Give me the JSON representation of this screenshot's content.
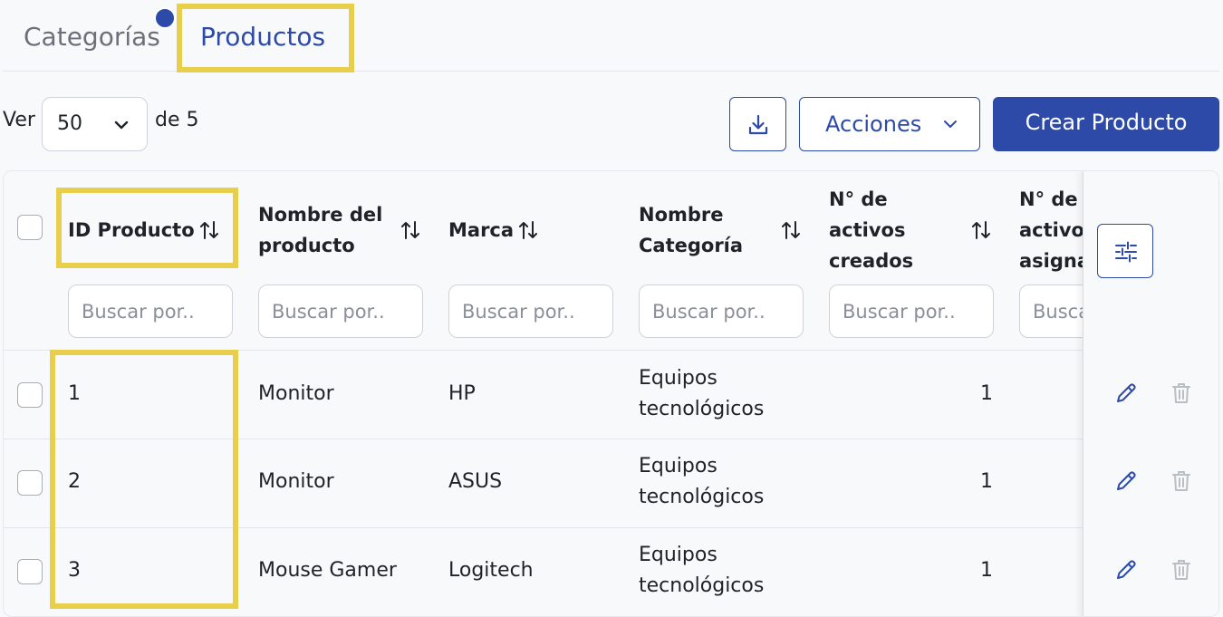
{
  "tabs": [
    {
      "label": "Categorías",
      "active": false
    },
    {
      "label": "Productos",
      "active": true
    }
  ],
  "toolbar": {
    "ver_label": "Ver",
    "page_size": "50",
    "de_label": "de 5",
    "download_icon": "download-icon",
    "acciones_label": "Acciones",
    "crear_label": "Crear Producto"
  },
  "table": {
    "columns": [
      {
        "label_lines": [
          "ID Producto"
        ]
      },
      {
        "label_lines": [
          "Nombre del",
          "producto"
        ]
      },
      {
        "label_lines": [
          "Marca"
        ]
      },
      {
        "label_lines": [
          "Nombre",
          "Categoría"
        ]
      },
      {
        "label_lines": [
          "N° de",
          "activos",
          "creados"
        ]
      },
      {
        "label_lines": [
          "N° de",
          "activos",
          "asigna"
        ]
      }
    ],
    "search_placeholder": "Buscar por..",
    "search_placeholder_truncated": "Busca",
    "rows": [
      {
        "id": "1",
        "nombre": "Monitor",
        "marca": "HP",
        "categoria": [
          "Equipos",
          "tecnológicos"
        ],
        "creados": "1"
      },
      {
        "id": "2",
        "nombre": "Monitor",
        "marca": "ASUS",
        "categoria": [
          "Equipos",
          "tecnológicos"
        ],
        "creados": "1"
      },
      {
        "id": "3",
        "nombre": "Mouse Gamer",
        "marca": "Logitech",
        "categoria": [
          "Equipos",
          "tecnológicos"
        ],
        "creados": "1"
      }
    ]
  },
  "colors": {
    "accent": "#2d4aa8",
    "highlight": "#e8cf4b",
    "muted": "#6b7079",
    "delete_disabled": "#b9bdc4"
  }
}
